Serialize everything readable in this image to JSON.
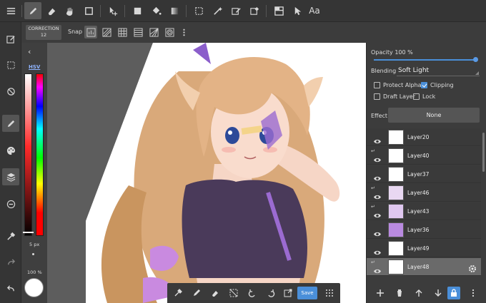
{
  "toolbar": {
    "text_tool_label": "Aa"
  },
  "subbar": {
    "correction_label": "CORRECTION",
    "correction_value": "12",
    "snap_label": "Snap"
  },
  "color_panel": {
    "mode_label": "HSV",
    "brush_size": "5 px",
    "brush_opacity": "100 %",
    "current_color": "#ffffff"
  },
  "canvas_bar": {
    "save_label": "Save"
  },
  "layer_panel": {
    "opacity_label": "Opacity 100 %",
    "opacity_value": 1.0,
    "blending_label": "Blending",
    "blending_value": "Soft Light",
    "protect_alpha_label": "Protect Alpha",
    "protect_alpha_checked": false,
    "clipping_label": "Clipping",
    "clipping_checked": true,
    "draft_layer_label": "Draft Layer",
    "draft_layer_checked": false,
    "lock_label": "Lock",
    "lock_checked": false,
    "effect_label": "Effect",
    "effect_value": "None",
    "layers": [
      {
        "name": "Layer20",
        "clipped": false,
        "selected": false
      },
      {
        "name": "Layer40",
        "clipped": true,
        "selected": false
      },
      {
        "name": "Layer37",
        "clipped": false,
        "selected": false
      },
      {
        "name": "Layer46",
        "clipped": true,
        "selected": false
      },
      {
        "name": "Layer43",
        "clipped": true,
        "selected": false
      },
      {
        "name": "Layer36",
        "clipped": false,
        "selected": false
      },
      {
        "name": "Layer49",
        "clipped": false,
        "selected": false
      },
      {
        "name": "Layer48",
        "clipped": true,
        "selected": true
      }
    ]
  },
  "colors": {
    "accent": "#4a8fd9",
    "hair": "#d9a97a",
    "shirt": "#4a3a5a"
  }
}
